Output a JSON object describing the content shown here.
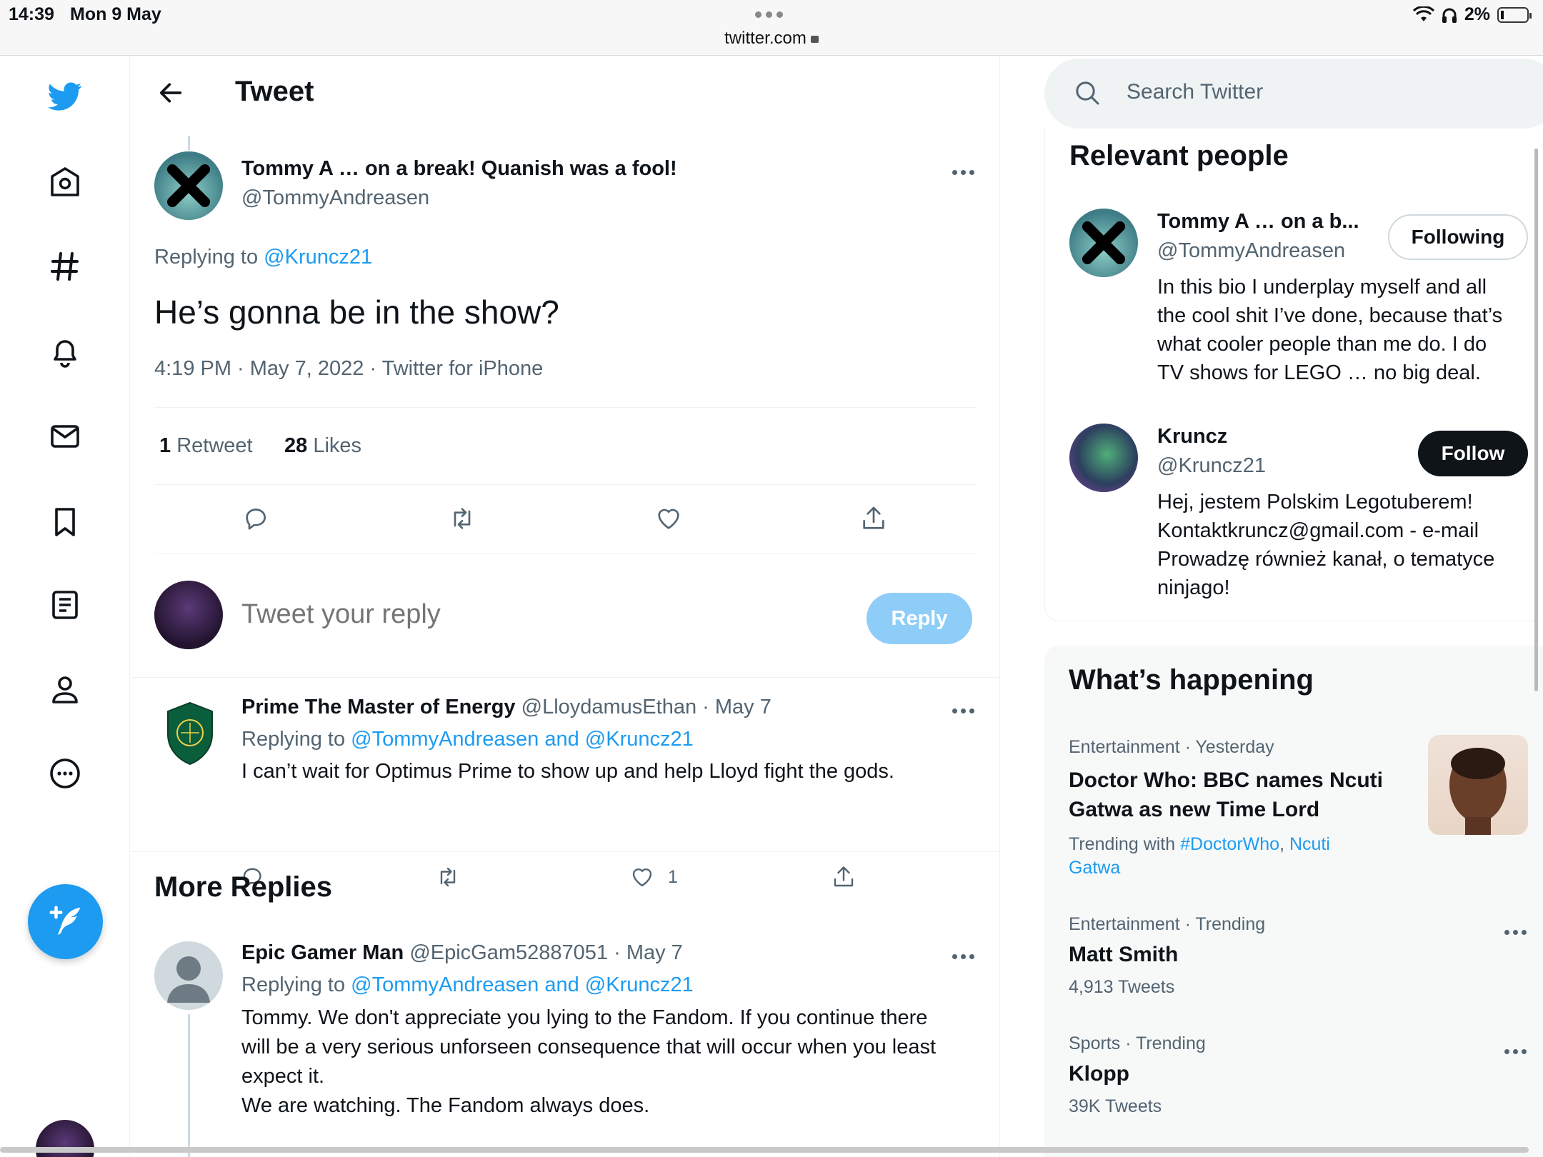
{
  "status": {
    "time": "14:39",
    "date": "Mon 9 May",
    "url": "twitter.com",
    "battery": "2%"
  },
  "header": {
    "title": "Tweet"
  },
  "tweet": {
    "author_name": "Tommy A … on a break! Quanish was a fool!",
    "author_handle": "@TommyAndreasen",
    "replying_prefix": "Replying to",
    "replying_to": "@Kruncz21",
    "text": "He’s gonna be in the show?",
    "meta": "4:19 PM · May 7, 2022 · Twitter for iPhone",
    "retweets_count": "1",
    "retweets_label": "Retweet",
    "likes_count": "28",
    "likes_label": "Likes"
  },
  "composer": {
    "placeholder": "Tweet your reply",
    "button": "Reply"
  },
  "replies": [
    {
      "name": "Prime The Master of Energy",
      "handle": "@LloydamusEthan",
      "date": "· May 7",
      "replying_prefix": "Replying to",
      "replying_to": "@TommyAndreasen and @Kruncz21",
      "text": "I can’t wait for Optimus Prime to show up and help Lloyd fight the gods.",
      "likes": "1"
    }
  ],
  "more_replies": {
    "title": "More Replies",
    "items": [
      {
        "name": "Epic Gamer Man",
        "handle": "@EpicGam52887051",
        "date": "· May 7",
        "replying_prefix": "Replying to",
        "replying_to": "@TommyAndreasen and @Kruncz21",
        "lines": [
          "Tommy. We don't appreciate you lying to the Fandom. If you continue there",
          "will be a very serious unforseen consequence that will occur when you least",
          "expect it.",
          "We are watching. The Fandom always does."
        ]
      }
    ]
  },
  "search": {
    "placeholder": "Search Twitter"
  },
  "relevant_people": {
    "title": "Relevant people",
    "people": [
      {
        "name": "Tommy A … on a b...",
        "handle": "@TommyAndreasen",
        "button": "Following",
        "bio": [
          "In this bio I underplay myself and all",
          "the cool shit I’ve done, because that’s",
          "what cooler people than me do. I do",
          "TV shows for LEGO … no big deal."
        ]
      },
      {
        "name": "Kruncz",
        "handle": "@Kruncz21",
        "button": "Follow",
        "bio": [
          "Hej, jestem Polskim Legotuberem!",
          "Kontaktkruncz@gmail.com - e-mail",
          "Prowadzę również kanał, o tematyce",
          "ninjago!"
        ]
      }
    ]
  },
  "whats_happening": {
    "title": "What’s happening",
    "trends": [
      {
        "meta": "Entertainment · Yesterday",
        "title_lines": [
          "Doctor Who: BBC names Ncuti",
          "Gatwa as new Time Lord"
        ],
        "with_prefix": "Trending with",
        "with_tag": "#DoctorWho",
        "with_sep": ",",
        "with_name_1": "Ncuti",
        "with_name_2": "Gatwa"
      },
      {
        "meta": "Entertainment · Trending",
        "title": "Matt Smith",
        "count": "4,913 Tweets"
      },
      {
        "meta": "Sports · Trending",
        "title": "Klopp",
        "count": "39K Tweets"
      }
    ]
  },
  "colors": {
    "accent": "#1d9bf0",
    "reply_button": "#8ecdf8",
    "text": "#0f1419",
    "muted": "#536471"
  }
}
